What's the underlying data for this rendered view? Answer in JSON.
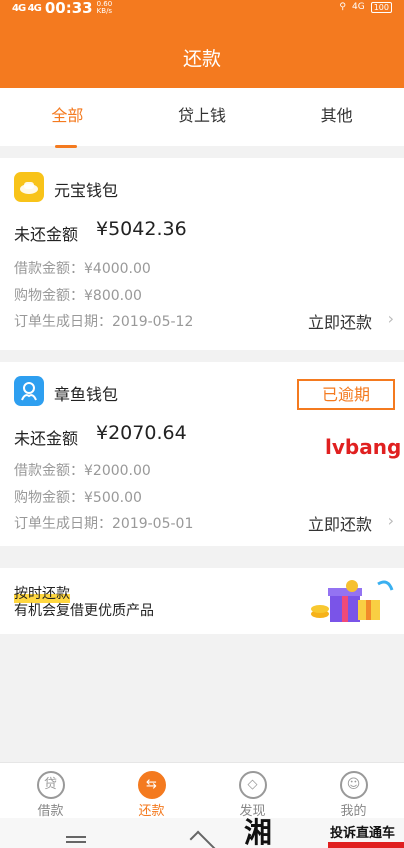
{
  "status_bar": {
    "signal": "4G 4G",
    "time": "00:33",
    "speed": "0.60",
    "speed_unit": "KB/s",
    "network": "4G",
    "battery": "100"
  },
  "header": {
    "title": "还款"
  },
  "tabs": [
    {
      "label": "全部",
      "active": true
    },
    {
      "label": "贷上钱",
      "active": false
    },
    {
      "label": "其他",
      "active": false
    }
  ],
  "cards": [
    {
      "wallet_name": "元宝钱包",
      "owed_label": "未还金额",
      "owed_amount": "¥5042.36",
      "loan_line": "借款金额：¥4000.00",
      "shopping_line": "购物金额：¥800.00",
      "date_line": "订单生成日期：2019-05-12",
      "action": "立即还款",
      "icon": "ingot-icon"
    },
    {
      "wallet_name": "章鱼钱包",
      "owed_label": "未还金额",
      "owed_amount": "¥2070.64",
      "loan_line": "借款金额：¥2000.00",
      "shopping_line": "购物金额：¥500.00",
      "date_line": "订单生成日期：2019-05-01",
      "action": "立即还款",
      "badge": "已逾期",
      "icon": "octopus-icon"
    }
  ],
  "watermark": "lvbang",
  "banner": {
    "title": "按时还款",
    "subtitle": "有机会复借更优质产品"
  },
  "bottom_nav": [
    {
      "label": "借款",
      "icon": "loan-icon",
      "glyph": "贷",
      "active": false
    },
    {
      "label": "还款",
      "icon": "repay-icon",
      "glyph": "⇆",
      "active": true
    },
    {
      "label": "发现",
      "icon": "compass-icon",
      "glyph": "◇",
      "active": false
    },
    {
      "label": "我的",
      "icon": "profile-icon",
      "glyph": "☺",
      "active": false
    }
  ],
  "system_bar": {
    "brand_logo": "湘问",
    "brand_text": "投诉直通车"
  },
  "colors": {
    "accent": "#f47a1f",
    "overdue": "#f47a1f",
    "watermark": "#e02020"
  }
}
